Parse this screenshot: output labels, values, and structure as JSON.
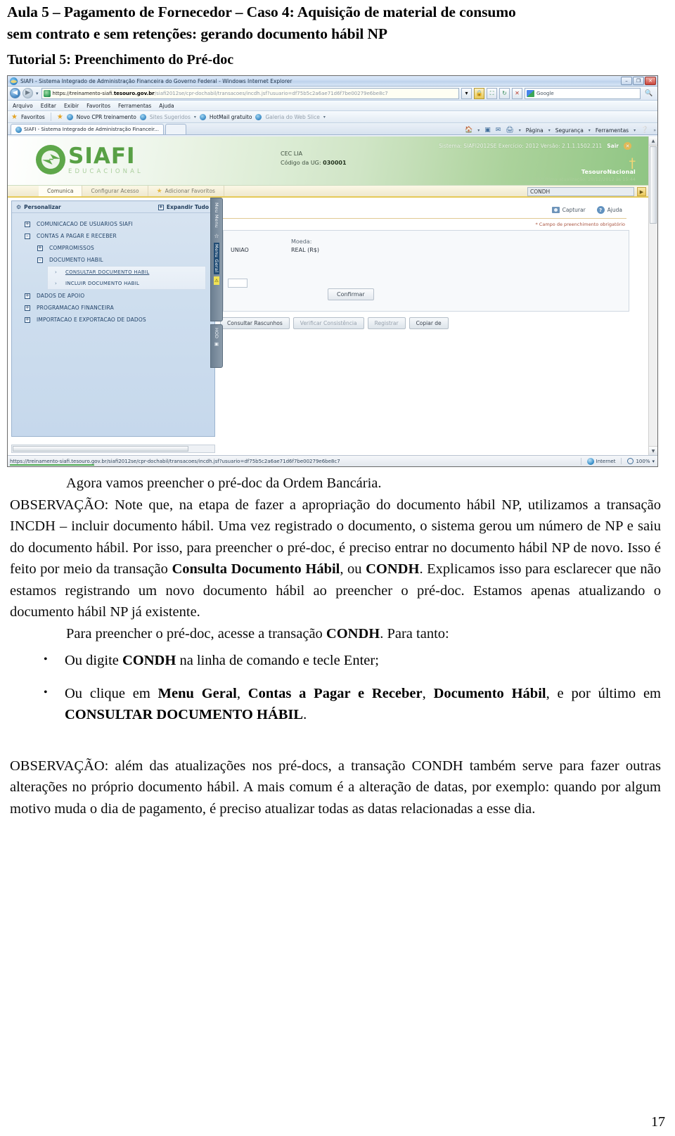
{
  "document": {
    "title_line1": "Aula 5 – Pagamento de Fornecedor – Caso 4: Aquisição de material de consumo",
    "title_line2": "sem contrato e sem retenções: gerando documento hábil NP",
    "subtitle": "Tutorial 5: Preenchimento do Pré-doc",
    "page_number": "17"
  },
  "browser": {
    "window_title": "SIAFI - Sistema Integrado de Administração Financeira do Governo Federal - Windows Internet Explorer",
    "window_buttons": {
      "minimize": "–",
      "restore": "❐",
      "close": "✕"
    },
    "nav": {
      "back": "◀",
      "forward": "▶",
      "history_caret": "▾"
    },
    "url": {
      "scheme": "https://treinamento-siafi.",
      "host": "tesouro.gov.br",
      "path": "/siafi2012se/cpr-dochabil/transacoes/incdh.jsf?usuario=df75b5c2a6ae71d6f7be00279e6be8c7"
    },
    "address_buttons": {
      "dropdown": "▾",
      "lock": "🔒",
      "compat": "⛶",
      "refresh": "↻",
      "stop": "✕"
    },
    "search": {
      "engine": "Google",
      "go": "🔍"
    },
    "menu": [
      "Arquivo",
      "Editar",
      "Exibir",
      "Favoritos",
      "Ferramentas",
      "Ajuda"
    ],
    "favorites_bar": {
      "label": "Favoritos",
      "items": [
        {
          "label": "Novo CPR treinamento",
          "dim": false,
          "caret": false
        },
        {
          "label": "Sites Sugeridos",
          "dim": true,
          "caret": true
        },
        {
          "label": "HotMail gratuito",
          "dim": false,
          "caret": false
        },
        {
          "label": "Galeria do Web Slice",
          "dim": true,
          "caret": true
        }
      ]
    },
    "tab": {
      "label": "SIAFI - Sistema Integrado de Administração Financeir..."
    },
    "command_bar": [
      "Página",
      "Segurança",
      "Ferramentas"
    ],
    "status": {
      "url": "https://treinamento-siafi.tesouro.gov.br/siafi2012se/cpr-dochabil/transacoes/incdh.jsf?usuario=df75b5c2a6ae71d6f7be00279e6be8c7",
      "zone": "Internet",
      "zoom": "100%"
    }
  },
  "siafi": {
    "logo": {
      "name": "SIAFI",
      "tagline": "EDUCACIONAL"
    },
    "user": {
      "name": "CEC LIA",
      "ug_label": "Código da UG:",
      "ug_value": "030001"
    },
    "system_info": "Sistema: SIAFI2012SE Exercício: 2012 Versão: 2.1.1.1502.211",
    "logout": "Sair",
    "treasury": "TesouroNacional",
    "last_update": "2.1.1.1502Última atualização: 20/12/2012 às 15:44",
    "tabs": [
      {
        "label": "Comunica",
        "active": true,
        "icon": null
      },
      {
        "label": "Configurar Acesso",
        "active": false,
        "icon": null
      },
      {
        "label": "Adicionar Favoritos",
        "active": false,
        "icon": "star-icon"
      }
    ],
    "command_line": {
      "value": "CONDH",
      "go": "▶"
    },
    "tree": {
      "personalizar": "Personalizar",
      "expandir": "Expandir Tudo",
      "nodes": [
        {
          "label": "COMUNICACAO DE USUARIOS SIAFI",
          "level": 1,
          "expander": "+"
        },
        {
          "label": "CONTAS A PAGAR E RECEBER",
          "level": 1,
          "expander": "–"
        },
        {
          "label": "COMPROMISSOS",
          "level": 2,
          "expander": "+"
        },
        {
          "label": "DOCUMENTO HABIL",
          "level": 2,
          "expander": "–"
        }
      ],
      "sub_items": [
        {
          "label": "CONSULTAR DOCUMENTO HABIL",
          "selected": true
        },
        {
          "label": "INCLUIR DOCUMENTO HABIL",
          "selected": false
        }
      ],
      "nodes_after": [
        {
          "label": "DADOS DE APOIO",
          "level": 1,
          "expander": "+"
        },
        {
          "label": "PROGRAMACAO FINANCEIRA",
          "level": 1,
          "expander": "+"
        },
        {
          "label": "IMPORTACAO E EXPORTACAO DE DADOS",
          "level": 1,
          "expander": "+"
        }
      ]
    },
    "rail": {
      "meu_menu": "Meu Menu",
      "menu_geral": "Menu Geral",
      "hod": "HOD"
    },
    "form": {
      "capturar": "Capturar",
      "ajuda": "Ajuda",
      "required_note": "* Campo de preenchimento obrigatório",
      "uniao_value": "UNIAO",
      "moeda_label": "Moeda:",
      "moeda_value": "REAL (R$)",
      "confirmar": "Confirmar",
      "buttons": [
        {
          "label": "Consultar Rascunhos",
          "dim": false
        },
        {
          "label": "Verificar Consistência",
          "dim": true
        },
        {
          "label": "Registrar",
          "dim": true
        },
        {
          "label": "Copiar de",
          "dim": false
        }
      ]
    }
  },
  "body": {
    "lead": "Agora vamos preencher o pré-doc da Ordem Bancária.",
    "p1_a": "OBSERVAÇÃO: Note que, na etapa de fazer a apropriação do documento hábil NP, utilizamos a transação INCDH – incluir documento hábil. Uma vez registrado o documento, o sistema gerou um número de NP e saiu do documento hábil. Por isso, para preencher o pré-doc, é preciso entrar no documento hábil NP de novo. Isso é feito por meio da transação ",
    "p1_b": "Consulta Documento Hábil",
    "p1_c": ", ou ",
    "p1_d": "CONDH",
    "p1_e": ". Explicamos isso para esclarecer que não estamos registrando um novo documento hábil ao preencher o pré-doc. Estamos apenas atualizando o documento hábil NP já existente.",
    "p2_a": "Para preencher o pré-doc, acesse a transação ",
    "p2_b": "CONDH",
    "p2_c": ". Para tanto:",
    "bullet1_a": "Ou digite ",
    "bullet1_b": "CONDH",
    "bullet1_c": " na linha de comando e tecle Enter;",
    "bullet2_a": "Ou clique em ",
    "bullet2_b": "Menu Geral",
    "bullet2_c": ", ",
    "bullet2_d": "Contas a Pagar e Receber",
    "bullet2_e": ", ",
    "bullet2_f": "Documento Hábil",
    "bullet2_g": ", e por último em ",
    "bullet2_h": "CONSULTAR DOCUMENTO HÁBIL",
    "bullet2_i": ".",
    "p3": "OBSERVAÇÃO: além das atualizações nos pré-docs, a transação CONDH também serve para fazer outras alterações no próprio documento hábil. A mais comum é a alteração de datas, por exemplo: quando por algum motivo muda o dia de pagamento, é preciso atualizar todas as datas relacionadas a esse dia."
  }
}
